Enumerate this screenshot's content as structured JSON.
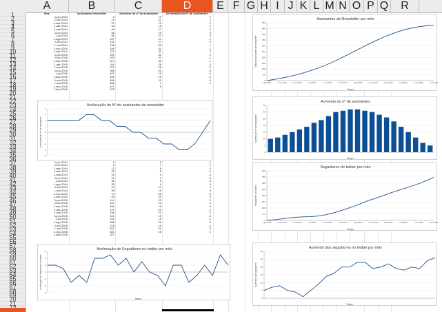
{
  "columns": [
    "A",
    "B",
    "C",
    "D",
    "E",
    "F",
    "G",
    "H",
    "I",
    "J",
    "K",
    "L",
    "M",
    "N",
    "O",
    "P",
    "Q",
    "R"
  ],
  "active_column": "D",
  "rows": [
    "1",
    "2",
    "3",
    "4",
    "5",
    "6",
    "7",
    "8",
    "9",
    "10",
    "11",
    "12",
    "13",
    "14",
    "15",
    "16",
    "17",
    "18",
    "19",
    "20",
    "21",
    "22",
    "23",
    "24",
    "25",
    "26",
    "27",
    "28",
    "29",
    "30",
    "31",
    "32",
    "33",
    "34",
    "35",
    "36",
    "37",
    "38",
    "39",
    "40",
    "41",
    "42",
    "43",
    "44",
    "45",
    "46",
    "47",
    "48",
    "49",
    "50",
    "51",
    "52",
    "53",
    "54",
    "55",
    "56",
    "57",
    "58",
    "59",
    "60",
    "61",
    "62",
    "63",
    "64",
    "65",
    "66",
    "67",
    "68",
    "69",
    "70",
    "71",
    "72"
  ],
  "table1": {
    "headers": [
      "Mês",
      "Assinantes Newsletter",
      "Aumento do nº de assinantes",
      "Aceleração do Nº de Assinantes"
    ],
    "rows": [
      [
        "1-jan-2014",
        "0",
        "10",
        "2"
      ],
      [
        "1-fev-2014",
        "10",
        "11",
        "2"
      ],
      [
        "1-mar-2014",
        "21",
        "13",
        "2"
      ],
      [
        "1-abr-2014",
        "34",
        "15",
        "2"
      ],
      [
        "1-mai-2014",
        "49",
        "17",
        "2"
      ],
      [
        "1-jun-2014",
        "66",
        "19",
        "3"
      ],
      [
        "1-jul-2014",
        "85",
        "22",
        "3"
      ],
      [
        "1-ago-2014",
        "107",
        "24",
        "2"
      ],
      [
        "1-set-2014",
        "131",
        "27",
        "2"
      ],
      [
        "1-out-2014",
        "158",
        "30",
        "1"
      ],
      [
        "1-nov-2014",
        "188",
        "31",
        "1"
      ],
      [
        "1-dez-2014",
        "219",
        "32",
        "0"
      ],
      [
        "1-jan-2015",
        "251",
        "32",
        "0"
      ],
      [
        "1-fev-2015",
        "283",
        "31",
        "-1"
      ],
      [
        "1-mar-2015",
        "314",
        "30",
        "-1"
      ],
      [
        "1-abr-2015",
        "344",
        "28",
        "-2"
      ],
      [
        "1-mai-2015",
        "372",
        "26",
        "-2"
      ],
      [
        "1-jun-2015",
        "398",
        "23",
        "-3"
      ],
      [
        "1-jul-2015",
        "421",
        "19",
        "-3"
      ],
      [
        "1-ago-2015",
        "440",
        "15",
        "-2"
      ],
      [
        "1-set-2015",
        "455",
        "11",
        "0"
      ],
      [
        "1-out-2015",
        "466",
        "7",
        "2"
      ],
      [
        "1-nov-2015",
        "473",
        "5",
        ""
      ],
      [
        "1-dez-2015",
        "478",
        "",
        ""
      ]
    ]
  },
  "table2": {
    "headers": [
      "Mês",
      "Seguidores no Twitter",
      "Aumento de seguidores",
      "Aceleração de Seguidores"
    ],
    "rows": [
      [
        "1-jan-2014",
        "0",
        "5",
        "2"
      ],
      [
        "1-fev-2014",
        "5",
        "7",
        "1"
      ],
      [
        "1-mar-2014",
        "12",
        "8",
        "-3"
      ],
      [
        "1-abr-2014",
        "20",
        "5",
        "-1"
      ],
      [
        "1-mai-2014",
        "25",
        "4",
        "-3"
      ],
      [
        "1-jun-2014",
        "29",
        "1",
        "4"
      ],
      [
        "1-jul-2014",
        "30",
        "5",
        "4"
      ],
      [
        "1-ago-2014",
        "35",
        "9",
        "5"
      ],
      [
        "1-set-2014",
        "44",
        "14",
        "2"
      ],
      [
        "1-out-2014",
        "58",
        "16",
        "4"
      ],
      [
        "1-nov-2014",
        "74",
        "20",
        "0"
      ],
      [
        "1-dez-2014",
        "94",
        "20",
        "3"
      ],
      [
        "1-jan-2015",
        "114",
        "23",
        "0"
      ],
      [
        "1-fev-2015",
        "137",
        "23",
        "-1"
      ],
      [
        "1-mar-2015",
        "160",
        "19",
        "-4"
      ],
      [
        "1-abr-2015",
        "179",
        "20",
        "2"
      ],
      [
        "1-mai-2015",
        "199",
        "22",
        "2"
      ],
      [
        "1-jun-2015",
        "221",
        "19",
        "-3"
      ],
      [
        "1-jul-2015",
        "240",
        "18",
        "-1"
      ],
      [
        "1-ago-2015",
        "258",
        "20",
        "2"
      ],
      [
        "1-set-2015",
        "278",
        "19",
        "-1"
      ],
      [
        "1-out-2015",
        "297",
        "24",
        "5"
      ],
      [
        "1-nov-2015",
        "321",
        "26",
        "2"
      ],
      [
        "1-dez-2015",
        "347",
        "",
        ""
      ]
    ]
  },
  "chart_data": [
    {
      "type": "line",
      "title": "Assinantes da Newsletter por mês",
      "xlabel": "Tempo",
      "ylabel": "Total de assinantes da newsletter",
      "ylim": [
        0,
        500
      ],
      "yticks": [
        "0",
        "50",
        "100",
        "150",
        "200",
        "250",
        "300",
        "350",
        "400",
        "450",
        "500"
      ],
      "xticks": [
        "1-jan-2014",
        "1-mar-2014",
        "1-mai-2014",
        "1-jul-2014",
        "1-set-2014",
        "1-nov-2014",
        "1-jan-2015",
        "1-mar-2015",
        "1-mai-2015",
        "1-jul-2015",
        "1-set-2015",
        "1-nov-2015"
      ],
      "values": [
        0,
        10,
        21,
        34,
        49,
        66,
        85,
        107,
        131,
        158,
        188,
        219,
        251,
        283,
        314,
        344,
        372,
        398,
        421,
        440,
        455,
        466,
        473,
        478
      ],
      "color": "#1f4e8c"
    },
    {
      "type": "bar",
      "title": "Aumento do nº de assinantes",
      "xlabel": "Tempo",
      "ylabel": "Aumento do nº de assinantes",
      "ylim": [
        0,
        35
      ],
      "yticks": [
        "0",
        "5",
        "10",
        "15",
        "20",
        "25",
        "30",
        "35"
      ],
      "values": [
        10,
        11,
        13,
        15,
        17,
        19,
        22,
        24,
        27,
        30,
        31,
        32,
        32,
        31,
        30,
        28,
        26,
        23,
        19,
        15,
        11,
        7,
        5
      ],
      "color": "#0b4f96"
    },
    {
      "type": "line",
      "title": "Seguidores do twitter por mês",
      "xlabel": "Tempo",
      "ylabel": "Seguidores do twitter",
      "ylim": [
        0,
        400
      ],
      "yticks": [
        "0",
        "50",
        "100",
        "150",
        "200",
        "250",
        "300",
        "350",
        "400"
      ],
      "xticks": [
        "1-jan-2014",
        "1-mar-2014",
        "1-mai-2014",
        "1-jul-2014",
        "1-set-2014",
        "1-nov-2014",
        "1-jan-2015",
        "1-mar-2015",
        "1-mai-2015",
        "1-jul-2015",
        "1-set-2015",
        "1-nov-2015"
      ],
      "values": [
        0,
        5,
        12,
        20,
        25,
        29,
        30,
        35,
        44,
        58,
        74,
        94,
        114,
        137,
        160,
        179,
        199,
        221,
        240,
        258,
        278,
        297,
        321,
        347
      ],
      "color": "#1f4e8c"
    },
    {
      "type": "line",
      "title": "Aceleração do Nº de assinantes da newsletter",
      "xlabel": "",
      "ylabel": "Aceleração do nº de assinantes",
      "ylim": [
        -4,
        4
      ],
      "yticks": [
        "-4",
        "-3",
        "-2",
        "-1",
        "0",
        "1",
        "2",
        "3",
        "4"
      ],
      "values": [
        2,
        2,
        2,
        2,
        2,
        3,
        3,
        2,
        2,
        1,
        1,
        0,
        0,
        -1,
        -1,
        -2,
        -2,
        -3,
        -3,
        -2,
        0,
        2
      ],
      "color": "#1f4e8c"
    },
    {
      "type": "bar",
      "title": "Aumento dos seguidores no twitter por mês",
      "xlabel": "Tempo",
      "ylabel": "Aumento dos seguidores",
      "ylim": [
        0,
        30
      ],
      "yticks": [
        "0",
        "5",
        "10",
        "15",
        "20",
        "25",
        "30"
      ],
      "values": [
        5,
        7,
        8,
        5,
        4,
        1,
        5,
        9,
        14,
        16,
        20,
        20,
        23,
        23,
        19,
        20,
        22,
        19,
        18,
        20,
        19,
        24,
        26
      ],
      "render": "line",
      "color": "#1f4e8c"
    },
    {
      "type": "line",
      "title": "Aceleração de Seguidores no twitter por mês",
      "xlabel": "Tempo",
      "ylabel": "Aceleração de Seguidores no twitter",
      "ylim": [
        -6,
        6
      ],
      "yticks": [
        "-6",
        "-4",
        "-2",
        "0",
        "2",
        "4",
        "6"
      ],
      "values": [
        2,
        2,
        1,
        -3,
        -1,
        -3,
        4,
        4,
        5,
        2,
        4,
        0,
        3,
        0,
        -1,
        -4,
        2,
        2,
        -3,
        -1,
        2,
        -1,
        5,
        2
      ],
      "color": "#1f4e8c"
    }
  ]
}
